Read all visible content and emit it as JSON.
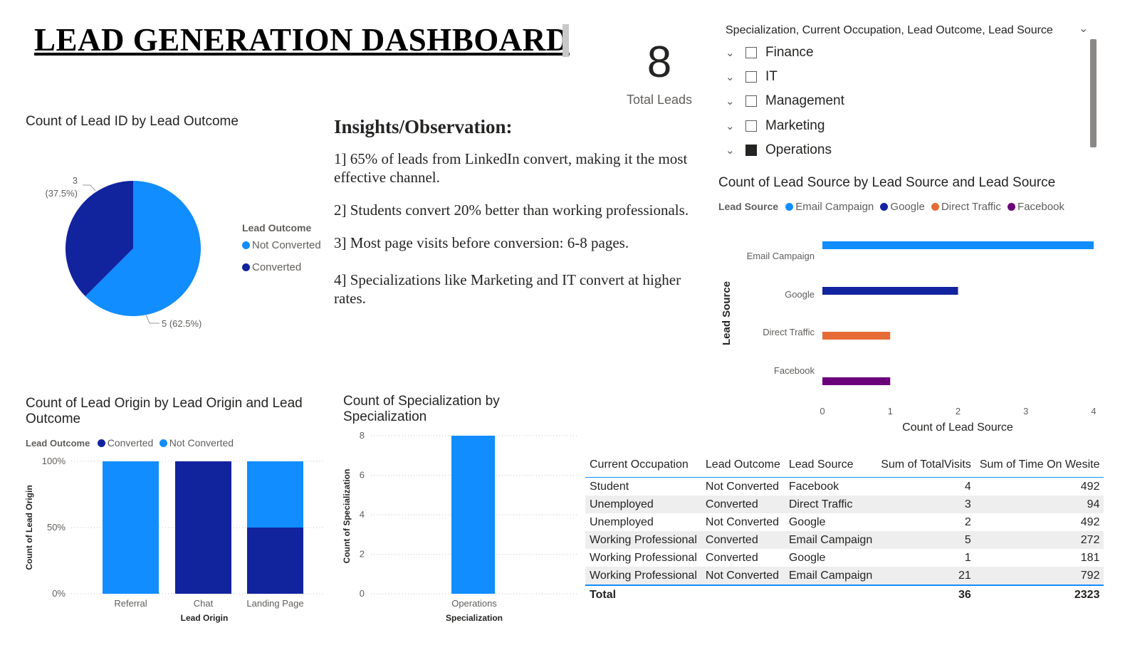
{
  "dashboard": {
    "title": "LEAD GENERATION DASHBOARD",
    "total_leads_value": "8",
    "total_leads_label": "Total Leads"
  },
  "colors": {
    "not_converted": "#118dff",
    "converted": "#12239e",
    "email_campaign": "#118dff",
    "google": "#12239e",
    "direct_traffic": "#e66c37",
    "facebook": "#6b007b"
  },
  "insights": {
    "heading": "Insights/Observation:",
    "items": [
      "1]  65% of leads from LinkedIn convert, making it the most effective channel.",
      "2] Students convert 20% better than working professionals.",
      "3] Most page visits before conversion: 6-8 pages.",
      "4] Specializations like Marketing and IT convert at higher rates."
    ]
  },
  "slicer": {
    "header": "Specialization, Current Occupation, Lead Outcome, Lead Source",
    "items": [
      {
        "label": "Finance",
        "checked": false
      },
      {
        "label": "IT",
        "checked": false
      },
      {
        "label": "Management",
        "checked": false
      },
      {
        "label": "Marketing",
        "checked": false
      },
      {
        "label": "Operations",
        "checked": true
      }
    ]
  },
  "table": {
    "columns": [
      "Current Occupation",
      "Lead Outcome",
      "Lead Source",
      "Sum of TotalVisits",
      "Sum of Time On Wesite"
    ],
    "rows": [
      [
        "Student",
        "Not Converted",
        "Facebook",
        "4",
        "492"
      ],
      [
        "Unemployed",
        "Converted",
        "Direct Traffic",
        "3",
        "94"
      ],
      [
        "Unemployed",
        "Not Converted",
        "Google",
        "2",
        "492"
      ],
      [
        "Working Professional",
        "Converted",
        "Email Campaign",
        "5",
        "272"
      ],
      [
        "Working Professional",
        "Converted",
        "Google",
        "1",
        "181"
      ],
      [
        "Working Professional",
        "Not Converted",
        "Email Campaign",
        "21",
        "792"
      ]
    ],
    "total": [
      "Total",
      "",
      "",
      "36",
      "2323"
    ]
  },
  "chart_data": [
    {
      "type": "pie",
      "title": "Count of Lead ID by Lead Outcome",
      "legend_title": "Lead Outcome",
      "legend_position": "right",
      "labels": [
        "Not Converted",
        "Converted"
      ],
      "values": [
        5,
        3
      ],
      "data_labels": [
        "5 (62.5%)",
        "3\n(37.5%)"
      ]
    },
    {
      "type": "bar",
      "orientation": "horizontal",
      "title": "Count of Lead Source by Lead Source and Lead Source",
      "legend_title": "Lead Source",
      "legend_position": "top-left",
      "categories": [
        "Email Campaign",
        "Google",
        "Direct Traffic",
        "Facebook"
      ],
      "values": [
        4,
        2,
        1,
        1
      ],
      "xlabel": "Count of Lead Source",
      "ylabel": "Lead Source",
      "xlim": [
        0,
        4
      ],
      "xticks": [
        "0",
        "1",
        "2",
        "3",
        "4"
      ],
      "grid": false
    },
    {
      "type": "bar",
      "stacking": "100%",
      "title": "Count of Lead Origin by Lead Origin and Lead Outcome",
      "legend_title": "Lead Outcome",
      "legend_position": "top-left",
      "categories": [
        "Referral",
        "Chat",
        "Landing Page"
      ],
      "series": [
        {
          "name": "Converted",
          "values": [
            0,
            100,
            50
          ]
        },
        {
          "name": "Not Converted",
          "values": [
            100,
            0,
            50
          ]
        }
      ],
      "xlabel": "Lead Origin",
      "ylabel": "Count of Lead Origin",
      "yticks": [
        "0%",
        "50%",
        "100%"
      ],
      "ylim": [
        0,
        100
      ],
      "grid": true
    },
    {
      "type": "bar",
      "title": "Count of Specialization by Specialization",
      "categories": [
        "Operations"
      ],
      "values": [
        8
      ],
      "xlabel": "Specialization",
      "ylabel": "Count of Specialization",
      "yticks": [
        "0",
        "2",
        "4",
        "6",
        "8"
      ],
      "ylim": [
        0,
        8
      ],
      "grid": true
    }
  ]
}
